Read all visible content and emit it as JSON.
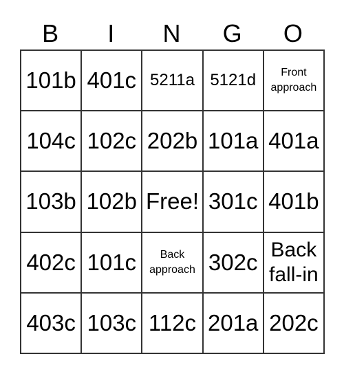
{
  "header": [
    "B",
    "I",
    "N",
    "G",
    "O"
  ],
  "cells": [
    [
      "101b",
      "401c",
      "5211a",
      "5121d",
      "Front approach"
    ],
    [
      "104c",
      "102c",
      "202b",
      "101a",
      "401a"
    ],
    [
      "103b",
      "102b",
      "Free!",
      "301c",
      "401b"
    ],
    [
      "402c",
      "101c",
      "Back approach",
      "302c",
      "Back fall-in"
    ],
    [
      "403c",
      "103c",
      "112c",
      "201a",
      "202c"
    ]
  ]
}
